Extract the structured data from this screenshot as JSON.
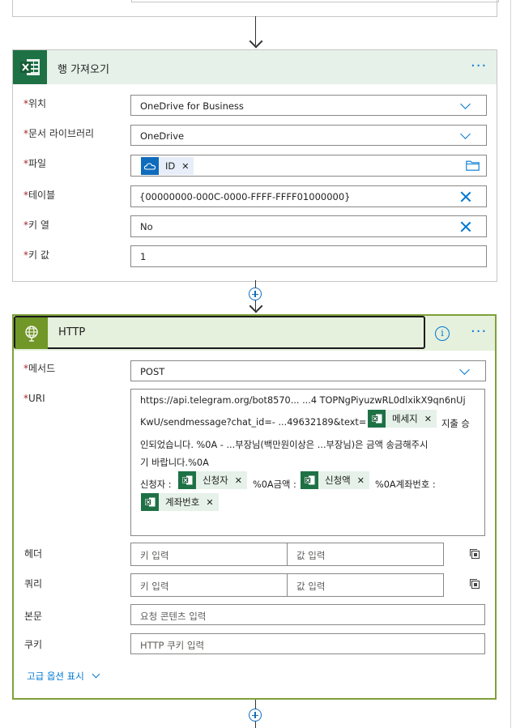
{
  "get_rows": {
    "title": "행 가져오기",
    "fields": [
      {
        "label": "위치",
        "value": "OneDrive for Business",
        "control": "dropdown"
      },
      {
        "label": "문서 라이브러리",
        "value": "OneDrive",
        "control": "dropdown"
      },
      {
        "label": "파일",
        "token": "ID",
        "control": "file"
      },
      {
        "label": "테이블",
        "value": "{00000000-000C-0000-FFFF-FFFF01000000}",
        "control": "clear"
      },
      {
        "label": "키 열",
        "value": "No",
        "control": "clear"
      },
      {
        "label": "키 값",
        "value": "1",
        "control": "text"
      }
    ]
  },
  "http": {
    "title": "HTTP",
    "method_label": "메서드",
    "method_value": "POST",
    "uri_label": "URI",
    "uri": {
      "line1": "https://api.telegram.org/bot8570...  ...4 TOPNgPiyuzwRL0dlxikX9qn6nUj",
      "line2a": "KwU/sendmessage?chat_id=- ...49632189&text=",
      "token_message": "메세지",
      "line2b": "지출 승",
      "line3": "인되었습니다. %0A -  ...부장님(백만원이상은  ...부장님)은 금액 송금해주시",
      "line4": "기 바랍니다.%0A",
      "line5a": "신청자 :",
      "token_applicant": "신청자",
      "line5b": "%0A금액 :",
      "token_amount": "신청액",
      "line5c": "%0A계좌번호 :",
      "token_account": "계좌번호"
    },
    "headers_label": "헤더",
    "queries_label": "쿼리",
    "key_placeholder": "키 입력",
    "value_placeholder": "값 입력",
    "body_label": "본문",
    "body_placeholder": "요청 콘텐츠 입력",
    "cookie_label": "쿠키",
    "cookie_placeholder": "HTTP 쿠키 입력",
    "advanced_label": "고급 옵션 표시"
  },
  "colors": {
    "accent": "#0078d4",
    "excel_green": "#1e7145",
    "http_header": "#e5f0dd",
    "http_border": "#7ea03b",
    "required": "#a4262c"
  },
  "icons": {
    "excel": "excel-icon",
    "http": "globe-icon",
    "more": "more-dots-icon",
    "info": "info-icon",
    "folder": "folder-icon",
    "onedrive": "onedrive-icon",
    "copy": "copy-icon",
    "add": "add-step-icon"
  }
}
